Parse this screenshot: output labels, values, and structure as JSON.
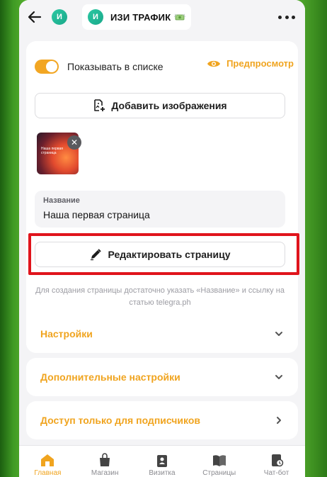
{
  "header": {
    "avatar_letter": "И",
    "title": "ИЗИ ТРАФИК",
    "title_emoji": "money-with-wings-icon"
  },
  "visibility": {
    "toggle_on": true,
    "label": "Показывать в списке",
    "preview_label": "Предпросмотр"
  },
  "images": {
    "add_label": "Добавить изображения",
    "thumbnail_text": "Наша первая страница"
  },
  "name_field": {
    "label": "Название",
    "value": "Наша первая страница"
  },
  "edit": {
    "label": "Редактировать страницу"
  },
  "hint": "Для создания страницы достаточно указать «Название» и ссылку на статью telegra.ph",
  "sections": [
    {
      "label": "Настройки",
      "icon": "chevron-down-icon"
    },
    {
      "label": "Дополнительные настройки",
      "icon": "chevron-down-icon"
    },
    {
      "label": "Доступ только для подписчиков",
      "icon": "chevron-right-icon"
    }
  ],
  "bottom_nav": [
    {
      "label": "Главная",
      "icon": "home-icon",
      "active": true
    },
    {
      "label": "Магазин",
      "icon": "shopping-bag-icon",
      "active": false
    },
    {
      "label": "Визитка",
      "icon": "badge-icon",
      "active": false
    },
    {
      "label": "Страницы",
      "icon": "book-icon",
      "active": false
    },
    {
      "label": "Чат-бот",
      "icon": "chat-bot-icon",
      "active": false
    }
  ],
  "colors": {
    "accent": "#f0a41f",
    "highlight": "#e0141c",
    "avatar": "#2bc8a3"
  }
}
